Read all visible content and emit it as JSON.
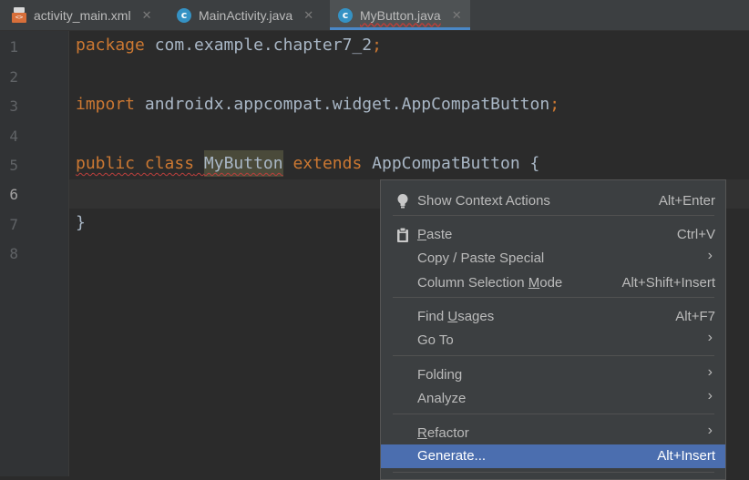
{
  "tabs": [
    {
      "label": "activity_main.xml",
      "icon": "xml-file-icon",
      "close": "✕"
    },
    {
      "label": "MainActivity.java",
      "icon": "class-c-icon",
      "close": "✕"
    },
    {
      "label": "MyButton.java",
      "icon": "class-c-icon",
      "close": "✕",
      "active": true
    }
  ],
  "line_numbers": [
    "1",
    "2",
    "3",
    "4",
    "5",
    "6",
    "7",
    "8"
  ],
  "code": {
    "line1": {
      "kw": "package",
      "rest": " com.example.chapter7_2",
      "semi": ";"
    },
    "line3": {
      "kw": "import",
      "rest": " androidx.appcompat.widget.AppCompatButton",
      "semi": ";"
    },
    "line5": {
      "kw1": "public class",
      "name": "MyButton",
      "kw2": "extends",
      "rest": "AppCompatButton {"
    },
    "line7": "}"
  },
  "context_menu": {
    "show_context_actions": {
      "label": "Show Context Actions",
      "shortcut": "Alt+Enter",
      "icon": "lightbulb-icon"
    },
    "paste": {
      "label": "Paste",
      "mnemonic": "P",
      "shortcut": "Ctrl+V",
      "icon": "clipboard-icon"
    },
    "copy_paste_special": {
      "label": "Copy / Paste Special",
      "arrow": "›"
    },
    "column_selection_mode": {
      "label_pre": "Column Selection ",
      "mnemonic": "M",
      "label_post": "ode",
      "shortcut": "Alt+Shift+Insert"
    },
    "find_usages": {
      "label_pre": "Find ",
      "mnemonic": "U",
      "label_post": "sages",
      "shortcut": "Alt+F7"
    },
    "go_to": {
      "label": "Go To",
      "arrow": "›"
    },
    "folding": {
      "label": "Folding",
      "arrow": "›"
    },
    "analyze": {
      "label": "Analyze",
      "arrow": "›"
    },
    "refactor": {
      "mnemonic": "R",
      "label_post": "efactor",
      "arrow": "›"
    },
    "generate": {
      "label": "Generate...",
      "shortcut": "Alt+Insert"
    }
  },
  "colors": {
    "editor_bg": "#2b2b2b",
    "keyword": "#cc7832",
    "text": "#a9b7c6",
    "menu_selection": "#4b6eaf",
    "tab_underline": "#4a88c7"
  }
}
